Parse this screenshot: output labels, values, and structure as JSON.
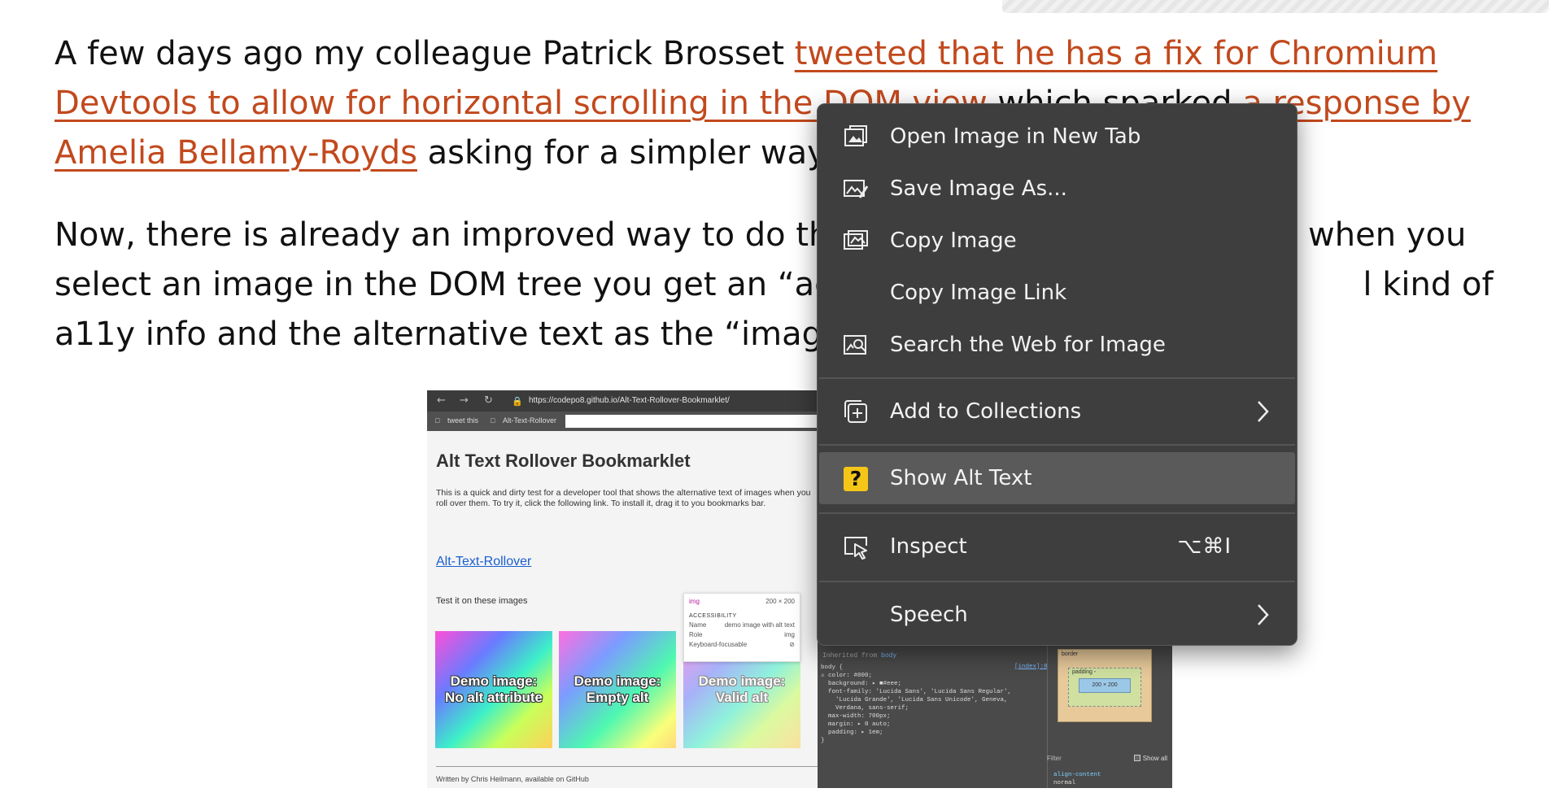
{
  "article": {
    "para1": {
      "text1": "A few days ago my colleague Patrick Brosset ",
      "link1": "tweeted that he has a fix for Chromium Devtools to allow for horizontal scrolling in the DOM view",
      "text2": " which sparked ",
      "link2": "a response by Amelia Bellamy-Royds",
      "text3": " asking for a simpler way to display alternat"
    },
    "para2": {
      "text": "Now, there is already an improved way to do that                                         - when you select an image in the DOM tree you get an “acces                                              l kind of a11y info and the alternative text as the “image name”."
    }
  },
  "screenshot": {
    "url": "https://codepo8.github.io/Alt-Text-Rollover-Bookmarklet/",
    "bookmarks": [
      "tweet this",
      "Alt-Text-Rollover"
    ],
    "title": "Alt Text Rollover Bookmarklet",
    "description": "This is a quick and dirty test for a developer tool that shows the alternative text of images when you roll over them. To try it, click the following link. To install it, drag it to you bookmarks bar.",
    "link": "Alt-Text-Rollover",
    "test_label": "Test it on these images",
    "demos": [
      {
        "line1": "Demo image:",
        "line2": "No alt attribute"
      },
      {
        "line1": "Demo image:",
        "line2": "Empty alt"
      },
      {
        "line1": "Demo image:",
        "line2": "Valid alt"
      }
    ],
    "footer": "Written by Chris Heilmann, available on GitHub",
    "tooltip": {
      "tag": "img",
      "size": "200 × 200",
      "section": "ACCESSIBILITY",
      "name_label": "Name",
      "name_value": "demo image with alt text",
      "role_label": "Role",
      "role_value": "img",
      "kbd_label": "Keyboard-focusable"
    },
    "devtools": {
      "inherited_prefix": "Inherited from ",
      "inherited_from": "body",
      "source": "[index]:8",
      "code": "body {\n⚠ color: #000;\n  background: ▸ ■#eee;\n  font-family: 'Lucida Sans', 'Lucida Sans Regular',\n    'Lucida Grande', 'Lucida Sans Unicode', Geneva,\n    Verdana, sans-serif;\n  max-width: 700px;\n  margin: ▸ 0 auto;\n  padding: ▸ 1em;\n}",
      "box_border": "border",
      "box_padding": "padding -",
      "box_content": "200 × 200",
      "filter": "Filter",
      "show_all": "Show all",
      "align_prop": "align-content",
      "align_val": "normal"
    }
  },
  "context_menu": {
    "items": [
      {
        "label": "Open Image in New Tab",
        "icon": "open-image-new-tab-icon"
      },
      {
        "label": "Save Image As...",
        "icon": "save-image-icon"
      },
      {
        "label": "Copy Image",
        "icon": "copy-image-icon"
      },
      {
        "label": "Copy Image Link",
        "icon": ""
      },
      {
        "label": "Search the Web for Image",
        "icon": "search-web-image-icon"
      },
      {
        "label": "Add to Collections",
        "icon": "add-to-collections-icon"
      },
      {
        "label": "Show Alt Text",
        "icon": "question-mark-icon",
        "badge": "?"
      },
      {
        "label": "Inspect",
        "icon": "inspect-icon",
        "shortcut": "⌥⌘I"
      },
      {
        "label": "Speech",
        "icon": ""
      }
    ]
  },
  "colors": {
    "link": "#c2491d",
    "menu_bg": "#3e3e3e",
    "menu_highlight": "#5a5a5a",
    "badge": "#f5c518"
  }
}
